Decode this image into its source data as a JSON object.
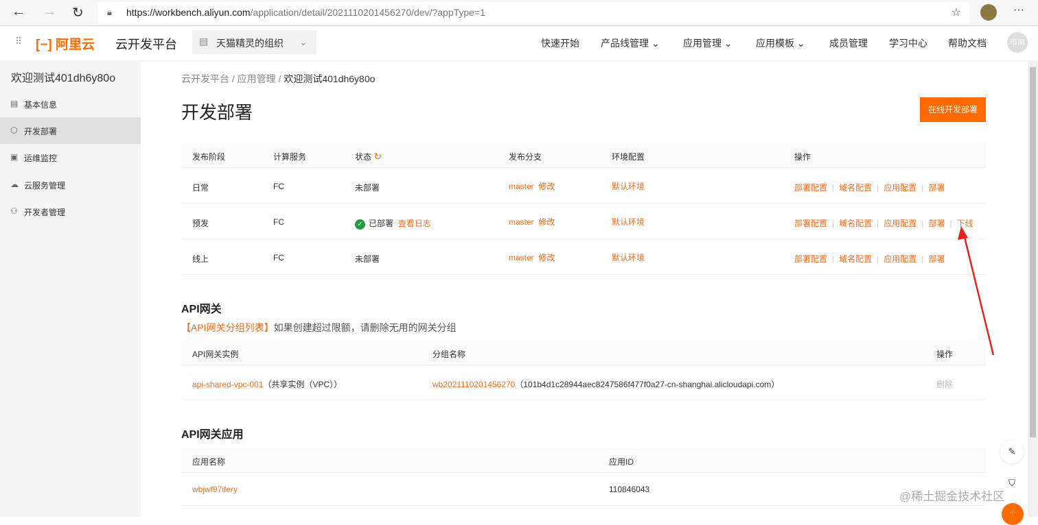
{
  "browser": {
    "url_host": "https://workbench.aliyun.com",
    "url_path": "/application/detail/2021110201456270/dev/?appType=1"
  },
  "topnav": {
    "logo": "阿里云",
    "product": "云开发平台",
    "org": "天猫精灵的组织",
    "items": [
      "快速开始",
      "产品线管理",
      "应用管理",
      "应用模板",
      "成员管理",
      "学习中心",
      "帮助文档"
    ],
    "avatar": "市南"
  },
  "sidebar": {
    "title": "欢迎测试401dh6y80o",
    "items": [
      {
        "label": "基本信息"
      },
      {
        "label": "开发部署"
      },
      {
        "label": "运维监控"
      },
      {
        "label": "云服务管理"
      },
      {
        "label": "开发者管理"
      }
    ]
  },
  "breadcrumb": [
    "云开发平台",
    "应用管理",
    "欢迎测试401dh6y80o"
  ],
  "page_title": "开发部署",
  "online_deploy_button": "在线开发部署",
  "deploy_table": {
    "headers": [
      "发布阶段",
      "计算服务",
      "状态",
      "发布分支",
      "环境配置",
      "操作"
    ],
    "rows": [
      {
        "stage": "日常",
        "compute": "FC",
        "status": "未部署",
        "log": "",
        "branch": "master",
        "edit": "修改",
        "env": "默认环境",
        "actions": [
          "部署配置",
          "域名配置",
          "应用配置",
          "部署"
        ]
      },
      {
        "stage": "预发",
        "compute": "FC",
        "status": "已部署",
        "log": "查看日志",
        "branch": "master",
        "edit": "修改",
        "env": "默认环境",
        "actions": [
          "部署配置",
          "域名配置",
          "应用配置",
          "部署",
          "下线"
        ]
      },
      {
        "stage": "线上",
        "compute": "FC",
        "status": "未部署",
        "log": "",
        "branch": "master",
        "edit": "修改",
        "env": "默认环境",
        "actions": [
          "部署配置",
          "域名配置",
          "应用配置",
          "部署"
        ]
      }
    ]
  },
  "api_gateway": {
    "title": "API网关",
    "link": "【API网关分组列表】",
    "note": "如果创建超过限额，请删除无用的网关分组",
    "headers": [
      "API网关实例",
      "分组名称",
      "操作"
    ],
    "rows": [
      {
        "instance": "api-shared-vpc-001",
        "instance_note": "（共享实例（VPC））",
        "group": "wb2021110201456270",
        "group_domain": "（101b4d1c28944aec8247586f477f0a27-cn-shanghai.alicloudapi.com）",
        "action": "删除"
      }
    ]
  },
  "api_apps": {
    "title": "API网关应用",
    "headers": [
      "应用名称",
      "应用ID"
    ],
    "rows": [
      {
        "name": "wbjwf97ifery",
        "id": "110846043"
      }
    ]
  },
  "watermark": "@稀土掘金技术社区",
  "colors": {
    "accent": "#ff6a00"
  }
}
